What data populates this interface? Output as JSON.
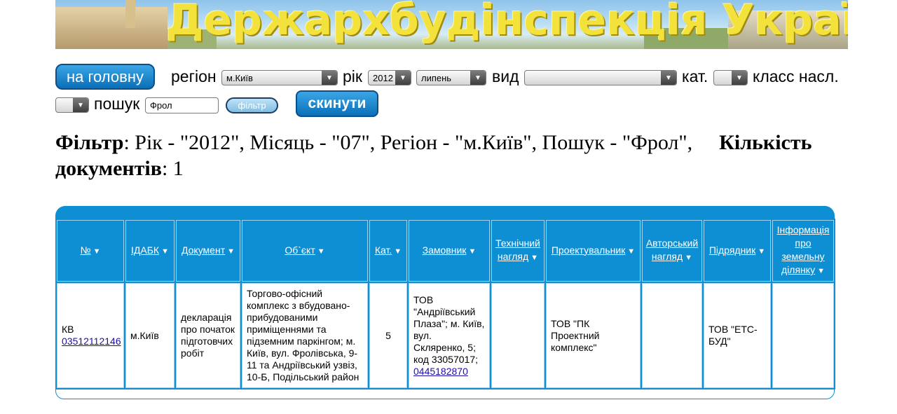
{
  "banner": {
    "title": "Держархбудінспекція України"
  },
  "nav": {
    "home_label": "на головну",
    "reset_label": "скинути",
    "filter_label": "фільтр"
  },
  "controls": {
    "region_label": "регіон",
    "region_value": "м.Київ",
    "year_label": "рік",
    "year_value": "2012",
    "month_value": "липень",
    "type_label": "вид",
    "type_value": "",
    "cat_label": "кат.",
    "cat_value": "",
    "class_label": "класс насл.",
    "class_value": "",
    "search_label": "пошук",
    "search_value": "Фрол"
  },
  "filter": {
    "label": "Фільтр",
    "text": ": Рік - \"2012\", Місяць - \"07\", Регіон - \"м.Київ\", Пошук - \"Фрол\",",
    "count_label": "Кількість документів",
    "count_value": ": 1"
  },
  "table": {
    "headers": {
      "num": "№",
      "idabk": "ІДАБК",
      "doc": "Документ",
      "object": "Об`єкт",
      "cat": "Кат.",
      "customer": "Замовник",
      "tech": "Технічний нагляд",
      "designer": "Проектувальник",
      "author": "Авторський нагляд",
      "contractor": "Підрядник",
      "land": "Інформація про земельну ділянку"
    },
    "rows": [
      {
        "num_prefix": "КВ",
        "num_link": "03512112146",
        "idabk": "м.Київ",
        "doc": "декларація про початок підготовчих робіт",
        "object": "Торгово-офісний комплекс з вбудовано-прибудованими приміщеннями та підземним паркінгом; м. Київ, вул. Фролівська, 9-11 та Андріївський узвіз, 10-Б, Подільський район",
        "cat": "5",
        "customer": "ТОВ \"Андріївський Плаза\"; м. Київ, вул. Скляренко, 5; код 33057017;",
        "customer_phone": "0445182870",
        "tech": "",
        "designer": "ТОВ \"ПК Проектний комплекс\"",
        "author": "",
        "contractor": "ТОВ \"ЕТС-БУД\"",
        "land": ""
      }
    ]
  },
  "colors": {
    "accent": "#0e8fd4",
    "button": "#0a6fb8",
    "banner_text": "#f4e23c"
  }
}
